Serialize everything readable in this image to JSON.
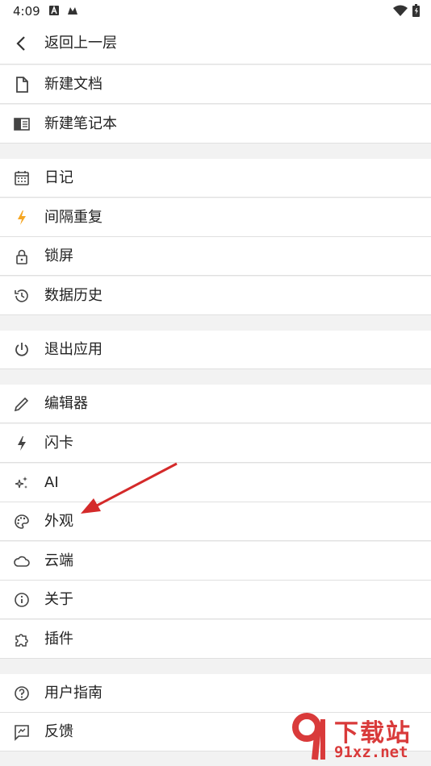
{
  "status_bar": {
    "time": "4:09"
  },
  "header": {
    "back_label": "返回上一层"
  },
  "menu": {
    "new_doc": "新建文档",
    "new_notebook": "新建笔记本",
    "diary": "日记",
    "spaced_repetition": "间隔重复",
    "lock_screen": "锁屏",
    "data_history": "数据历史",
    "exit_app": "退出应用",
    "editor": "编辑器",
    "flashcard": "闪卡",
    "ai": "AI",
    "appearance": "外观",
    "cloud": "云端",
    "about": "关于",
    "plugins": "插件",
    "user_guide": "用户指南",
    "feedback": "反馈"
  },
  "watermark": {
    "brand": "下载站",
    "domain": "91xz.net"
  },
  "colors": {
    "accent_bolt": "#f5a623",
    "arrow": "#d42a2a",
    "watermark": "#d93a3a"
  }
}
